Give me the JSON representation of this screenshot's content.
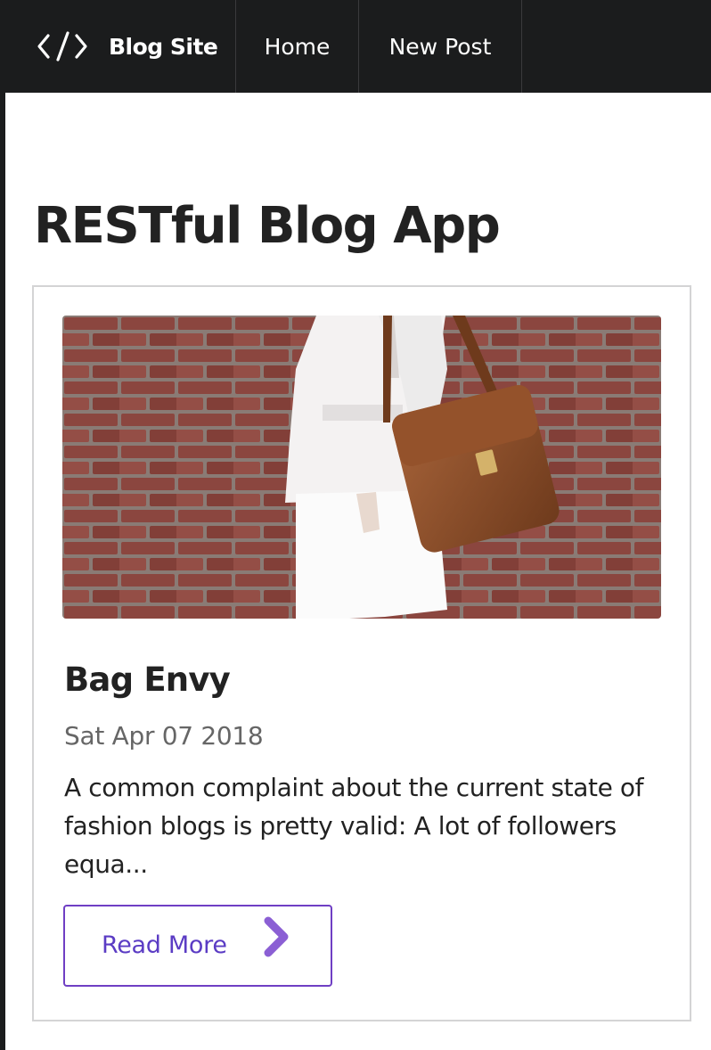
{
  "navbar": {
    "brand_icon": "code-icon",
    "brand": "Blog Site",
    "items": [
      {
        "label": "Home"
      },
      {
        "label": "New Post"
      }
    ]
  },
  "page": {
    "title": "RESTful Blog App"
  },
  "post": {
    "title": "Bag Envy",
    "date": "Sat Apr 07 2018",
    "excerpt": "A common complaint about the current state of fashion blogs is pretty valid: A lot of followers equa...",
    "read_more_label": "Read More",
    "read_more_icon": "chevron-right-icon"
  },
  "colors": {
    "navbar_bg": "#1b1c1d",
    "accent": "#6f3fc4",
    "card_border": "#d4d4d5"
  }
}
